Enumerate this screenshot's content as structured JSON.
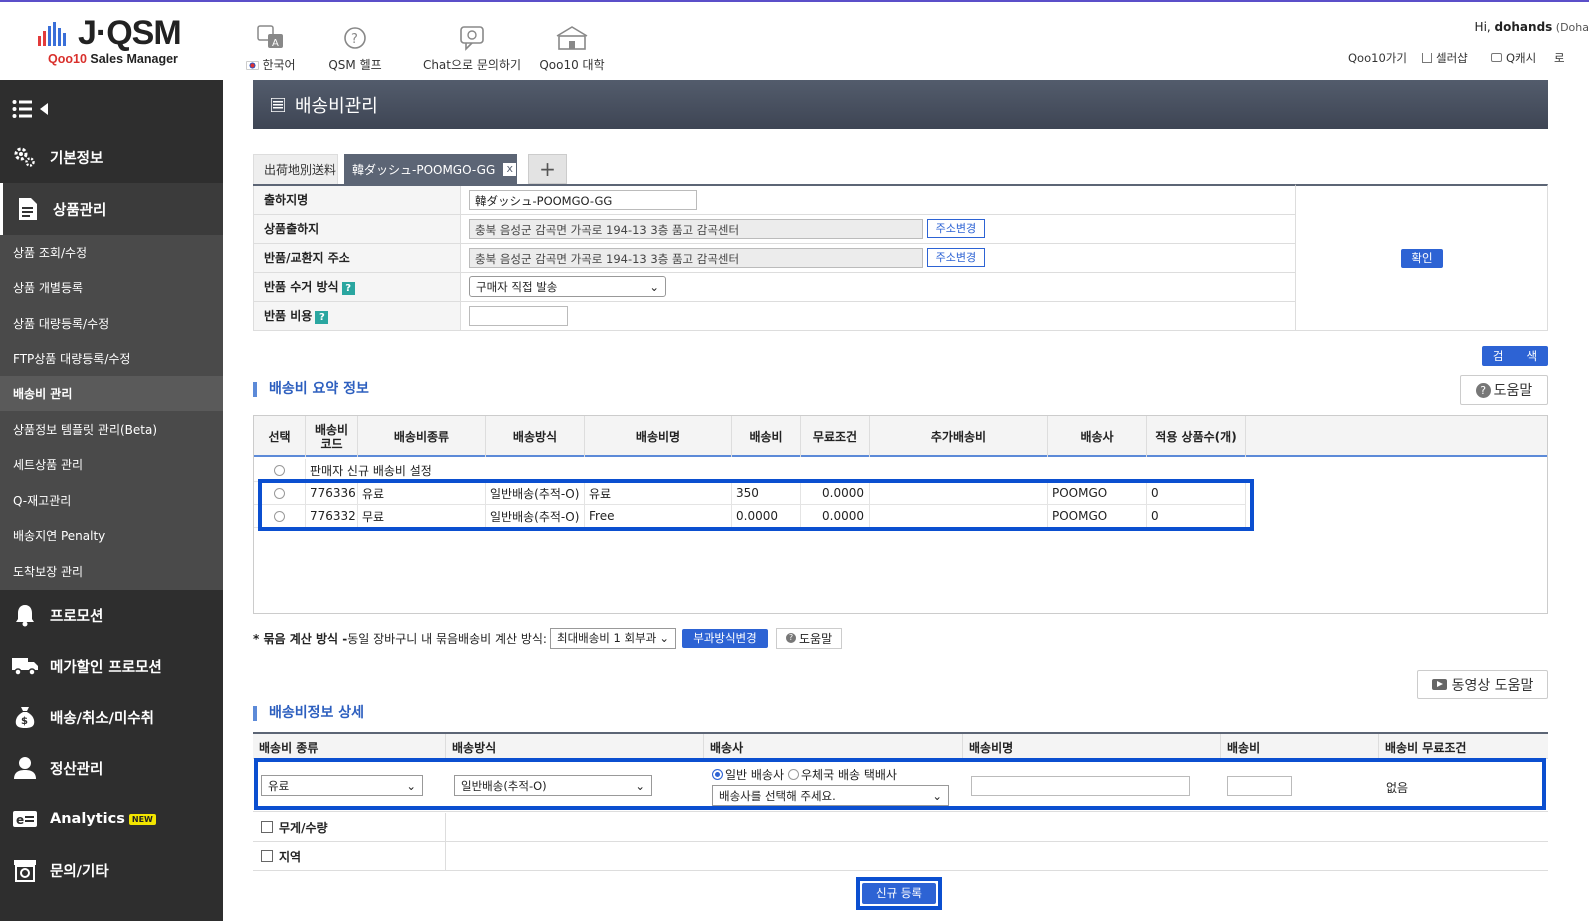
{
  "header": {
    "logo": {
      "brand": "J·QSM",
      "sub_prefix": "Qoo10",
      "sub_suffix": " Sales Manager"
    },
    "nav": [
      {
        "label": "한국어",
        "icon": "language-icon"
      },
      {
        "label": "QSM 헬프",
        "icon": "help-circle-icon"
      },
      {
        "label": "Chat으로 문의하기",
        "icon": "chat-icon"
      },
      {
        "label": "Qoo10 대학",
        "icon": "university-icon"
      }
    ],
    "greeting_prefix": "Hi, ",
    "user": "dohands",
    "user_suffix": " (Doha",
    "links": {
      "qoo10": "Qoo10가기",
      "seller_shop": "셀러샵",
      "qcash": "Q캐시",
      "logout": "로"
    }
  },
  "sidebar": {
    "main_items": [
      {
        "label": "기본정보",
        "icon": "gear-icon"
      },
      {
        "label": "상품관리",
        "icon": "document-icon"
      },
      {
        "label": "프로모션",
        "icon": "bell-icon"
      },
      {
        "label": "메가할인 프로모션",
        "icon": "truck-icon"
      },
      {
        "label": "배송/취소/미수취",
        "icon": "money-bag-icon"
      },
      {
        "label": "정산관리",
        "icon": "user-icon"
      },
      {
        "label": "Analytics",
        "icon": "analytics-icon",
        "badge": "NEW"
      },
      {
        "label": "문의/기타",
        "icon": "store-icon"
      }
    ],
    "sub_items": [
      "상품 조회/수정",
      "상품 개별등록",
      "상품 대량등록/수정",
      "FTP상품 대량등록/수정",
      "배송비 관리",
      "상품정보 템플릿 관리(Beta)",
      "세트상품 관리",
      "Q-재고관리",
      "배송지연 Penalty",
      "도착보장 관리"
    ]
  },
  "page": {
    "title": "배송비관리",
    "tabs": {
      "inactive": "出荷地別送料",
      "active": "韓ダッシュ-POOMGO-GG",
      "add": "+",
      "close": "x"
    },
    "form": {
      "rows": [
        {
          "label": "출하지명",
          "value": "韓ダッシュ-POOMGO-GG"
        },
        {
          "label": "상품출하지",
          "value": "충북 음성군 감곡면 가곡로 194-13 3층 품고 감곡센터",
          "button": "주소변경"
        },
        {
          "label": "반품/교환지 주소",
          "value": "충북 음성군 감곡면 가곡로 194-13 3층 품고 감곡센터",
          "button": "주소변경"
        },
        {
          "label": "반품 수거 방식",
          "value": "구매자 직접 발송",
          "help": "?"
        },
        {
          "label": "반품 비용",
          "value": "",
          "help": "?"
        }
      ],
      "confirm": "확인"
    },
    "search_button": "검　　색",
    "summary": {
      "title": "배송비 요약 정보",
      "help": "도움말",
      "columns": [
        "선택",
        "배송비\n코드",
        "배송비종류",
        "배송방식",
        "배송비명",
        "배송비",
        "무료조건",
        "추가배송비",
        "배송사",
        "적용 상품수(개)"
      ],
      "new_row": "판매자 신규 배송비 설정",
      "rows": [
        {
          "code": "776336",
          "kind": "유료",
          "method": "일반배송(추적-O)",
          "name": "유료",
          "fee": "350",
          "free_cond": "0.0000",
          "extra": "",
          "carrier": "POOMGO",
          "count": "0"
        },
        {
          "code": "776332",
          "kind": "무료",
          "method": "일반배송(추적-O)",
          "name": "Free",
          "fee": "0.0000",
          "free_cond": "0.0000",
          "extra": "",
          "carrier": "POOMGO",
          "count": "0"
        }
      ]
    },
    "bundle": {
      "label_bold": "* 묶음 계산 방식 - ",
      "label": "동일 장바구니 내 묶음배송비 계산 방식:",
      "select": "최대배송비 1 회부과",
      "change_button": "부과방식변경",
      "help": "도움말"
    },
    "video_help": "동영상 도움말",
    "detail": {
      "title": "배송비정보 상세",
      "columns": [
        "배송비 종류",
        "배송방식",
        "배송사",
        "배송비명",
        "배송비",
        "배송비 무료조건"
      ],
      "kind_select": "유료",
      "method_select": "일반배송(추적-O)",
      "carrier_radio1": "일반 배송사",
      "carrier_radio2": "우체국 배송 택배사",
      "carrier_select": "배송사를 선택해 주세요.",
      "name_value": "",
      "fee_value": "",
      "free_cond": "없음",
      "weight_label": "무게/수량",
      "region_label": "지역"
    },
    "register_button": "신규 등록"
  },
  "colors": {
    "accent": "#2d63d4",
    "highlight": "#0b4fd0",
    "sidebar": "#2e2e2e",
    "title_bar": "#4a5262"
  }
}
